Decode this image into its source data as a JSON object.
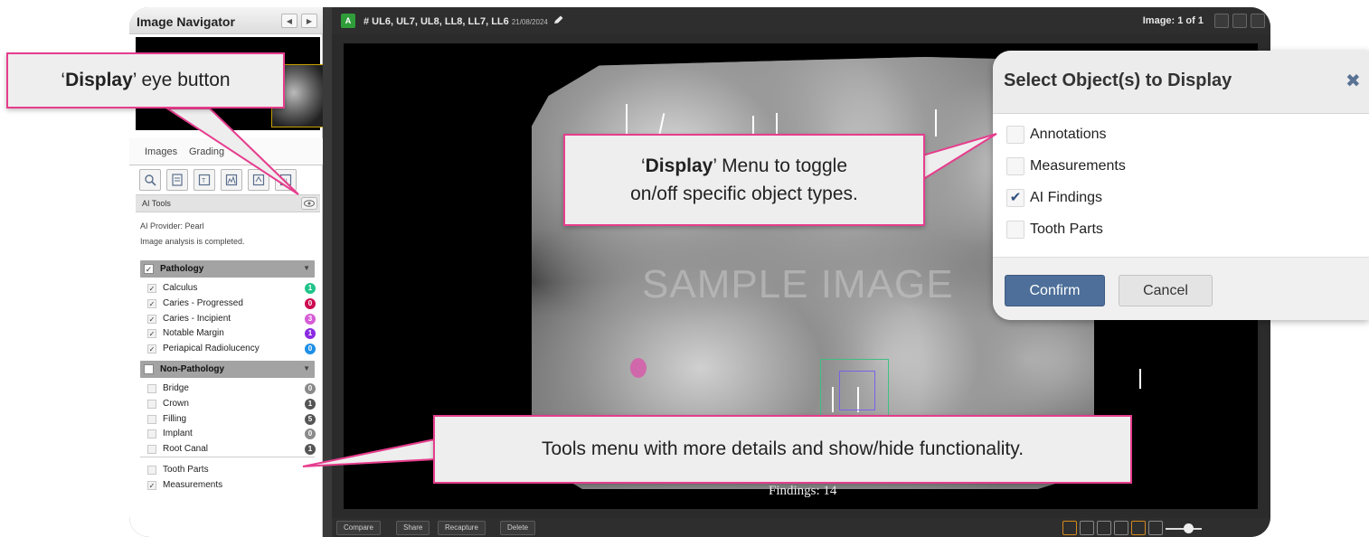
{
  "navigator": {
    "title": "Image Navigator",
    "prev_icon": "arrow-left",
    "next_icon": "arrow-right"
  },
  "side_tabs": [
    "Images",
    "Grading"
  ],
  "ai_tools": {
    "label": "AI Tools",
    "provider": "AI Provider: Pearl",
    "status": "Image analysis is completed."
  },
  "pathology": {
    "label": "Pathology",
    "checked": true,
    "items": [
      {
        "label": "Calculus",
        "checked": true,
        "count": "1",
        "color": "#1fc48a"
      },
      {
        "label": "Caries - Progressed",
        "checked": true,
        "count": "0",
        "color": "#cc0a4f"
      },
      {
        "label": "Caries - Incipient",
        "checked": true,
        "count": "3",
        "color": "#d65bd6"
      },
      {
        "label": "Notable Margin",
        "checked": true,
        "count": "1",
        "color": "#8a2be2"
      },
      {
        "label": "Periapical Radiolucency",
        "checked": true,
        "count": "0",
        "color": "#1e8fe6"
      }
    ]
  },
  "non_pathology": {
    "label": "Non-Pathology",
    "checked": false,
    "items": [
      {
        "label": "Bridge",
        "checked": false,
        "count": "0",
        "color": "#8a8a8a"
      },
      {
        "label": "Crown",
        "checked": false,
        "count": "1",
        "color": "#555555"
      },
      {
        "label": "Filling",
        "checked": false,
        "count": "5",
        "color": "#555555"
      },
      {
        "label": "Implant",
        "checked": false,
        "count": "0",
        "color": "#8a8a8a"
      },
      {
        "label": "Root Canal",
        "checked": false,
        "count": "1",
        "color": "#555555"
      }
    ]
  },
  "other_items": [
    {
      "label": "Tooth Parts",
      "checked": false
    },
    {
      "label": "Measurements",
      "checked": true
    }
  ],
  "viewer": {
    "badge": "A",
    "teeth": "# UL6, UL7, UL8, LL8, LL7, LL6",
    "date": "21/08/2024",
    "image_count": "Image: 1 of 1",
    "watermark": "SAMPLE IMAGE",
    "findings": "Findings: 14"
  },
  "bottom_buttons": [
    "Compare",
    "Share",
    "Recapture",
    "Delete"
  ],
  "select_panel": {
    "title": "Select Object(s) to Display",
    "close_icon": "close-x",
    "options": [
      {
        "label": "Annotations",
        "checked": false
      },
      {
        "label": "Measurements",
        "checked": false
      },
      {
        "label": "AI Findings",
        "checked": true
      },
      {
        "label": "Tooth Parts",
        "checked": false
      }
    ],
    "confirm": "Confirm",
    "cancel": "Cancel"
  },
  "callouts": {
    "eye": {
      "quote_open": "‘",
      "bold": "Display",
      "rest": "’ eye button"
    },
    "menu": {
      "quote_open": "‘",
      "bold": "Display",
      "rest_1": "’ Menu to toggle",
      "line_2": "on/off specific object types."
    },
    "tools": "Tools menu with more details and show/hide functionality."
  },
  "colors": {
    "callout_border": "#e63d8d",
    "confirm_blue": "#4d6f99",
    "badge_green": "#2f9e3a"
  }
}
